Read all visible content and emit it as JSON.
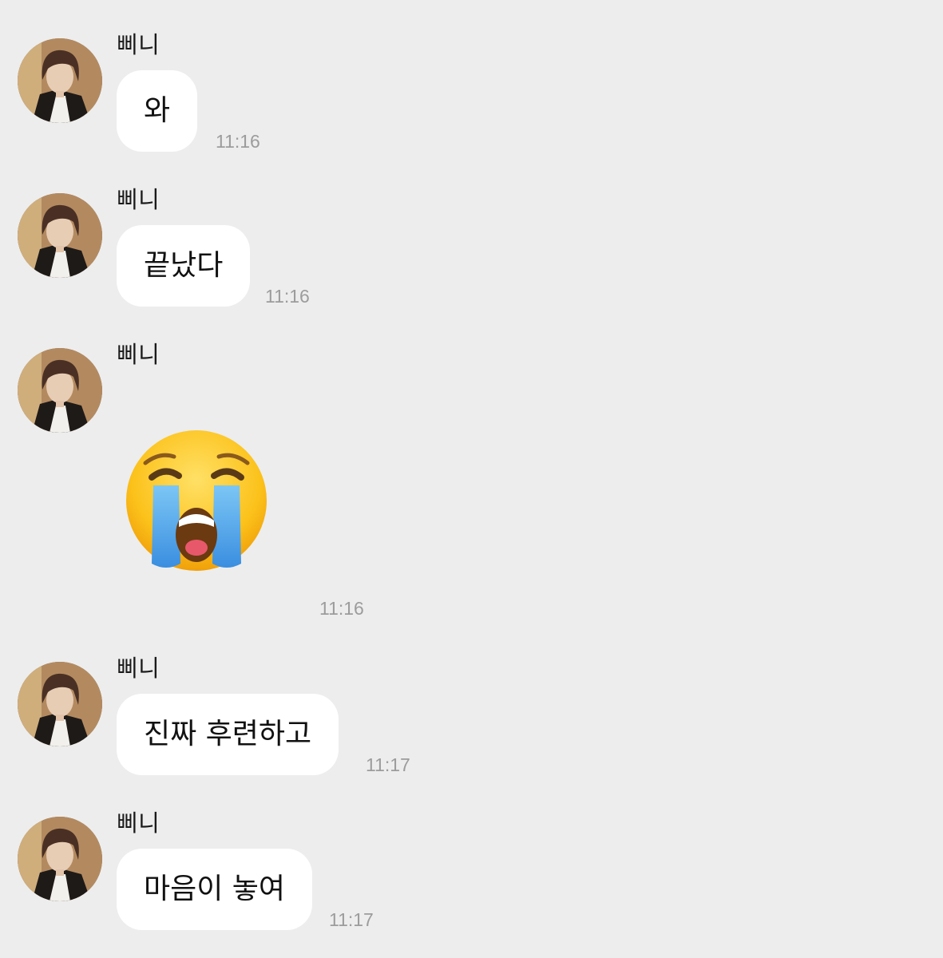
{
  "messages": [
    {
      "sender": "삐니",
      "text": "와",
      "time": "11:16"
    },
    {
      "sender": "삐니",
      "text": "끝났다",
      "time": "11:16"
    },
    {
      "sender": "삐니",
      "emoji": "loudly-crying-face",
      "time": "11:16"
    },
    {
      "sender": "삐니",
      "text": "진짜 후련하고",
      "time": "11:17"
    },
    {
      "sender": "삐니",
      "text": "마음이 놓여",
      "time": "11:17"
    }
  ],
  "colors": {
    "background": "#ededed",
    "bubble": "#ffffff",
    "timestamp": "#9c9c9c"
  }
}
